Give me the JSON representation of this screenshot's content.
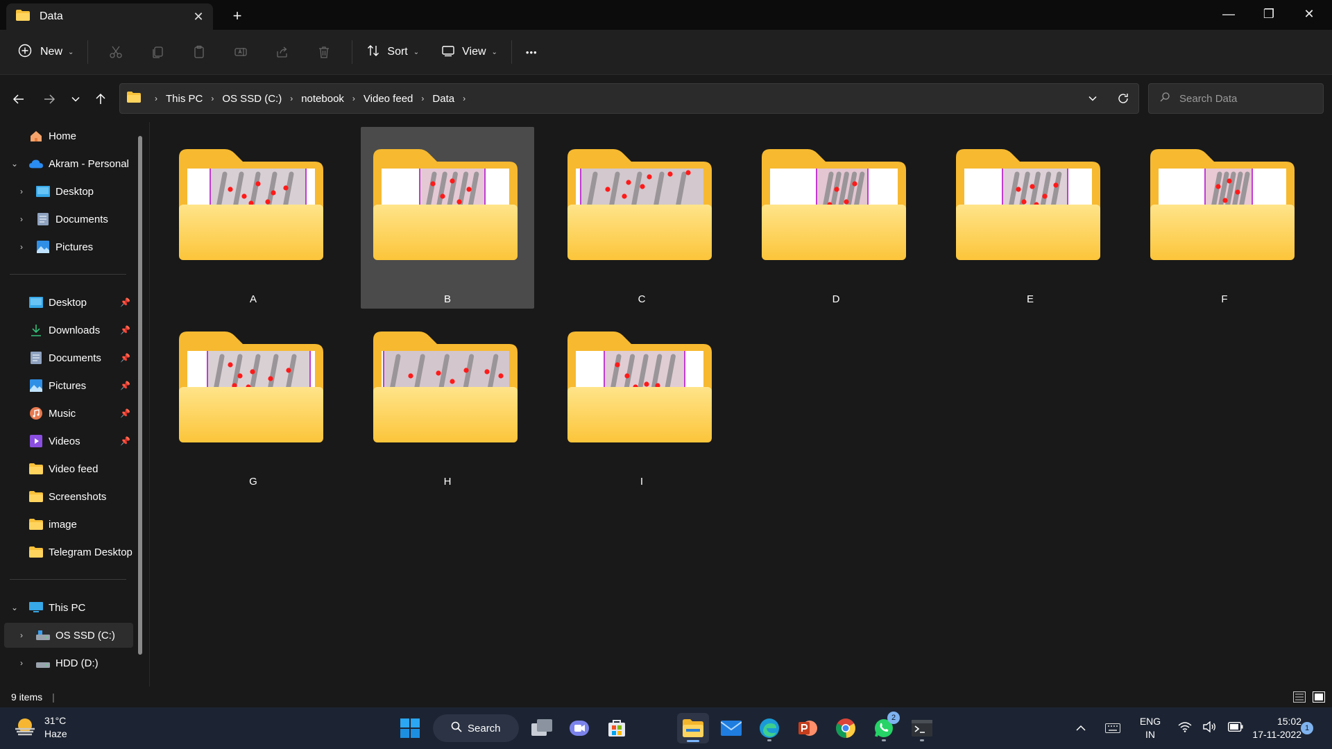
{
  "window": {
    "tab_title": "Data",
    "new_tab": "+",
    "minimize": "—",
    "maximize": "❐",
    "close": "✕"
  },
  "toolbar": {
    "new_label": "New",
    "sort_label": "Sort",
    "view_label": "View",
    "more_label": "•••"
  },
  "address": {
    "crumbs": [
      "This PC",
      "OS SSD (C:)",
      "notebook",
      "Video feed",
      "Data"
    ],
    "search_placeholder": "Search Data"
  },
  "sidebar": {
    "home": "Home",
    "onedrive": "Akram - Personal",
    "od_desktop": "Desktop",
    "od_documents": "Documents",
    "od_pictures": "Pictures",
    "quick": [
      "Desktop",
      "Downloads",
      "Documents",
      "Pictures",
      "Music",
      "Videos",
      "Video feed",
      "Screenshots",
      "image",
      "Telegram Desktop"
    ],
    "this_pc": "This PC",
    "drive_c": "OS SSD (C:)",
    "drive_d": "HDD (D:)"
  },
  "folders": [
    "A",
    "B",
    "C",
    "D",
    "E",
    "F",
    "G",
    "H",
    "I"
  ],
  "status": {
    "item_count": "9 items"
  },
  "taskbar": {
    "search_label": "Search",
    "weather_temp": "31°C",
    "weather_desc": "Haze",
    "lang_line1": "ENG",
    "lang_line2": "IN",
    "time": "15:02",
    "date": "17-11-2022",
    "whatsapp_badge": "2",
    "notification_badge": "1"
  }
}
